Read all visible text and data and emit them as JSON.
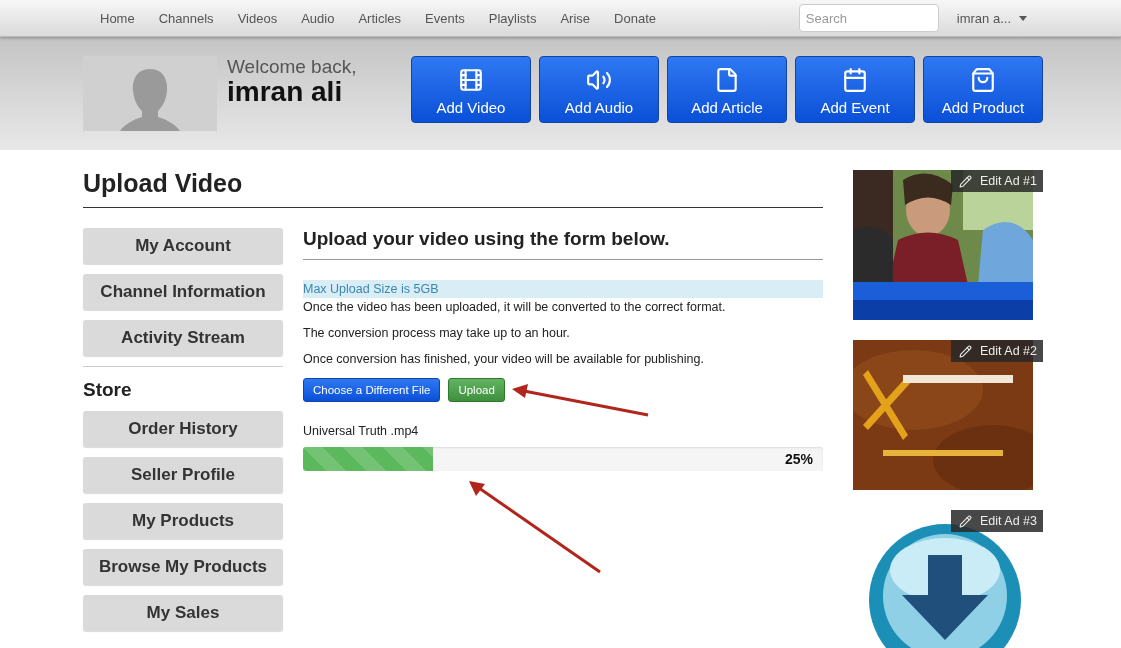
{
  "nav": {
    "links": [
      "Home",
      "Channels",
      "Videos",
      "Audio",
      "Articles",
      "Events",
      "Playlists",
      "Arise",
      "Donate"
    ],
    "search": {
      "placeholder": "Search"
    },
    "user_menu": "imran a..."
  },
  "welcome": {
    "greeting": "Welcome back,",
    "name": "imran ali"
  },
  "quick_actions": [
    {
      "kind": "video",
      "label": "Add Video"
    },
    {
      "kind": "audio",
      "label": "Add Audio"
    },
    {
      "kind": "article",
      "label": "Add Article"
    },
    {
      "kind": "event",
      "label": "Add Event"
    },
    {
      "kind": "product",
      "label": "Add Product"
    }
  ],
  "page_title": "Upload Video",
  "sidebar": {
    "account_items": [
      "My Account",
      "Channel Information",
      "Activity Stream"
    ],
    "store_heading": "Store",
    "store_items": [
      "Order History",
      "Seller Profile",
      "My Products",
      "Browse My Products",
      "My Sales"
    ]
  },
  "upload": {
    "heading": "Upload your video using the form below.",
    "notice": "Max Upload Size is 5GB",
    "paragraphs": [
      "Once the video has been uploaded, it will be converted to the correct format.",
      "The conversion process may take up to an hour.",
      "Once conversion has finished, your video will be available for publishing."
    ],
    "buttons": [
      {
        "kind": "primary",
        "label": "Choose a Different File"
      },
      {
        "kind": "success",
        "label": "Upload"
      }
    ],
    "file_name": "Universal Truth .mp4",
    "progress": {
      "level": 0.25,
      "reading": "25%"
    }
  },
  "ads": [
    {
      "kind": "picture",
      "edit_label": "Edit Ad #1"
    },
    {
      "kind": "picture",
      "edit_label": "Edit Ad #2"
    },
    {
      "kind": "picture",
      "edit_label": "Edit Ad #3"
    }
  ]
}
